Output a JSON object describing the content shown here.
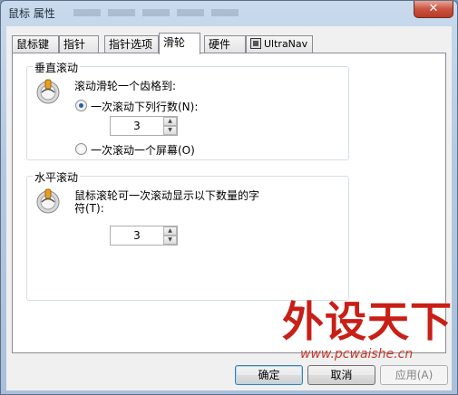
{
  "window": {
    "title": "鼠标 属性",
    "close_glyph": "✕"
  },
  "tabs": [
    {
      "label": "鼠标键"
    },
    {
      "label": "指针"
    },
    {
      "label": "指针选项"
    },
    {
      "label": "滑轮",
      "active": true
    },
    {
      "label": "硬件"
    },
    {
      "label": "UltraNav",
      "icon": "ultranav-icon"
    }
  ],
  "vertical_scroll": {
    "title": "垂直滚动",
    "prompt": "滚动滑轮一个齿格到:",
    "option_lines": "一次滚动下列行数(N):",
    "lines_value": "3",
    "option_screen": "一次滚动一个屏幕(O)",
    "selected": "lines"
  },
  "horizontal_scroll": {
    "title": "水平滚动",
    "prompt_line1": "鼠标滚轮可一次滚动显示以下数量的字",
    "prompt_line2": "符(T):",
    "chars_value": "3"
  },
  "buttons": {
    "ok": "确定",
    "cancel": "取消",
    "apply": "应用(A)"
  },
  "watermark": {
    "brand": "外设天下",
    "url": "www.pcwaishe.cn"
  },
  "icons": {
    "wheel": "mouse-wheel-icon",
    "spin_up": "spin-up-icon",
    "spin_down": "spin-down-icon"
  }
}
